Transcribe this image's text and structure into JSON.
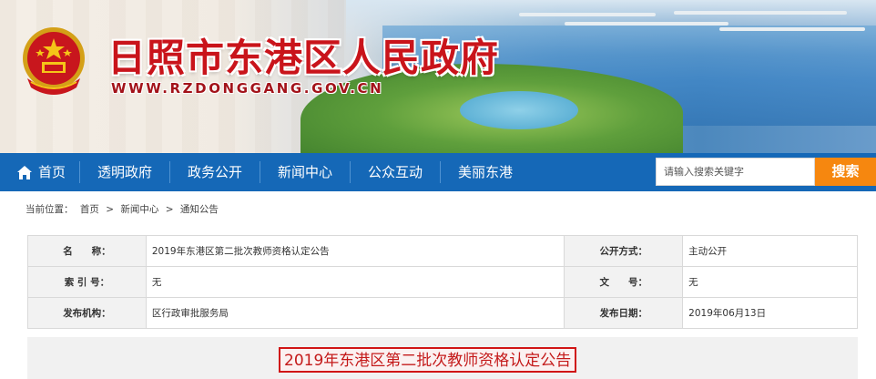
{
  "header": {
    "site_title": "日照市东港区人民政府",
    "site_url": "WWW.RZDONGGANG.GOV.CN"
  },
  "nav": {
    "items": [
      {
        "label": "首页",
        "icon": "home-icon"
      },
      {
        "label": "透明政府"
      },
      {
        "label": "政务公开"
      },
      {
        "label": "新闻中心"
      },
      {
        "label": "公众互动"
      },
      {
        "label": "美丽东港"
      }
    ],
    "bg_color": "#1568b7"
  },
  "search": {
    "placeholder": "请输入搜索关键字",
    "button_label": "搜索",
    "button_color": "#f6870f"
  },
  "breadcrumb": {
    "prefix": "当前位置：",
    "items": [
      "首页",
      "新闻中心",
      "通知公告"
    ],
    "separator": ">"
  },
  "info": {
    "name_label": "名　　称：",
    "name_value": "2019年东港区第二批次教师资格认定公告",
    "open_mode_label": "公开方式：",
    "open_mode_value": "主动公开",
    "index_label": "索 引 号：",
    "index_value": "无",
    "doc_no_label": "文　　号：",
    "doc_no_value": "无",
    "publisher_label": "发布机构：",
    "publisher_value": "区行政审批服务局",
    "date_label": "发布日期：",
    "date_value": "2019年06月13日"
  },
  "article": {
    "title": "2019年东港区第二批次教师资格认定公告",
    "title_color": "#c41a1a"
  }
}
